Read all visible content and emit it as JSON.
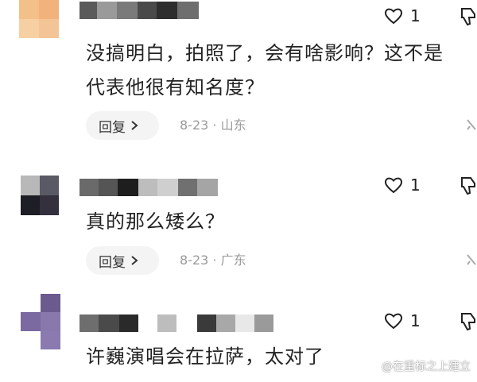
{
  "comments": [
    {
      "text": "没搞明白，拍照了，会有啥影响？这不是代表他很有知名度？",
      "reply_label": "回复",
      "date": "8-23",
      "location": "山东",
      "likes": "1"
    },
    {
      "text": "真的那么矮么？",
      "reply_label": "回复",
      "date": "8-23",
      "location": "广东",
      "likes": "1"
    },
    {
      "text": "许巍演唱会在拉萨，太对了",
      "likes": "1"
    }
  ],
  "watermark": "@在重标之上建立",
  "icons": [
    "heart-icon",
    "dislike-icon",
    "chevron-right-icon",
    "more-icon"
  ],
  "colors": {
    "meta_gray": "#9a9a9a",
    "reply_bg": "#f4f4f4"
  }
}
